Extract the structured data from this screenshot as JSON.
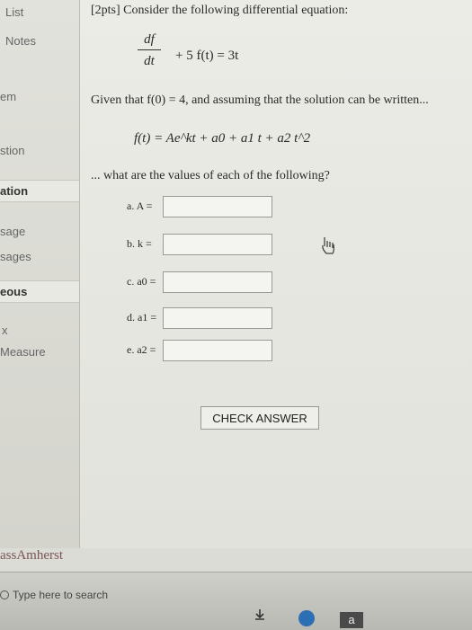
{
  "sidebar": {
    "items": [
      {
        "label": "List"
      },
      {
        "label": "Notes"
      },
      {
        "label": "em"
      },
      {
        "label": "stion"
      },
      {
        "label": "ation"
      },
      {
        "label": "sage"
      },
      {
        "label": "sages"
      },
      {
        "label": "eous"
      },
      {
        "label": "x"
      },
      {
        "label": "Measure"
      }
    ]
  },
  "question": {
    "title": "[2pts] Consider the following differential equation:",
    "eq_num": "df",
    "eq_den": "dt",
    "eq_rest": "+ 5 f(t) = 3t",
    "given": "Given that f(0) = 4, and assuming that the solution can be written...",
    "solution": "f(t) = Ae^kt + a0 + a1 t + a2 t^2",
    "prompt": "... what are the values of each of the following?"
  },
  "answers": [
    {
      "label": "a. A ="
    },
    {
      "label": "b. k ="
    },
    {
      "label": "c. a0 ="
    },
    {
      "label": "d. a1 ="
    },
    {
      "label": "e. a2 ="
    }
  ],
  "check_label": "CHECK ANSWER",
  "footer": {
    "logo": "assAmherst"
  },
  "taskbar": {
    "search_placeholder": "Type here to search",
    "app_letter": "a"
  },
  "colors": {
    "edge_icon": "#2d6fb4"
  }
}
